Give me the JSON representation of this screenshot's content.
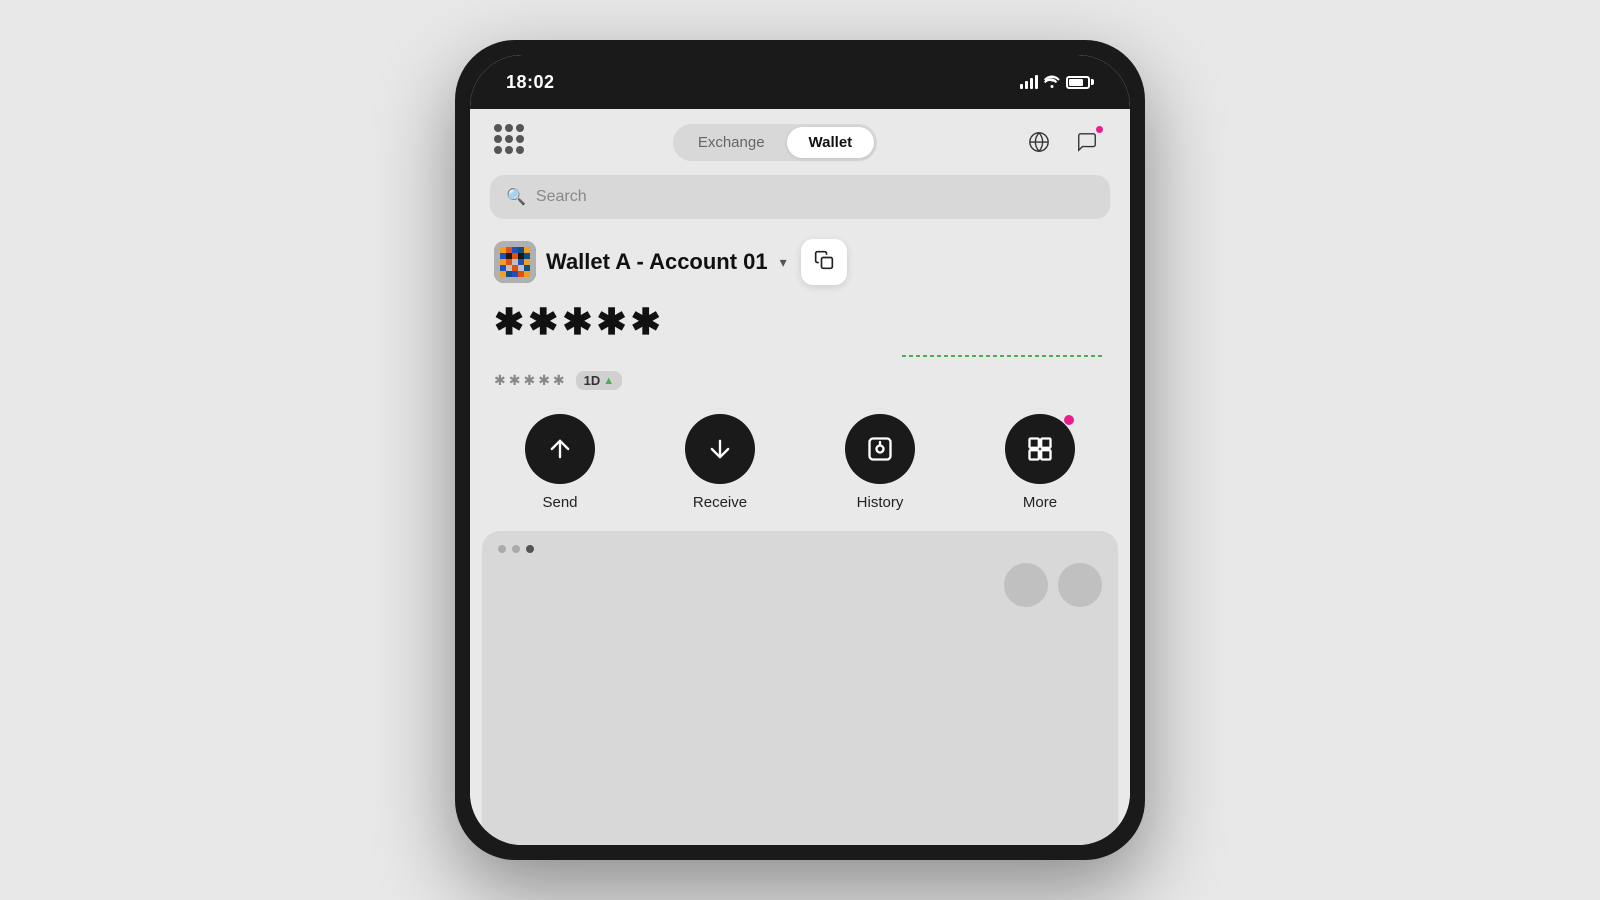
{
  "page": {
    "background": "#e8e8e8"
  },
  "statusBar": {
    "time": "18:02"
  },
  "nav": {
    "tabs": [
      {
        "id": "exchange",
        "label": "Exchange",
        "active": false
      },
      {
        "id": "wallet",
        "label": "Wallet",
        "active": true
      }
    ],
    "searchPlaceholder": "Search"
  },
  "wallet": {
    "accountName": "Wallet A - Account 01",
    "balanceMasked": "✱✱✱✱✱",
    "subBalanceMasked": "✱✱✱✱✱",
    "period": "1D",
    "periodDirection": "▲"
  },
  "actions": [
    {
      "id": "send",
      "label": "Send"
    },
    {
      "id": "receive",
      "label": "Receive"
    },
    {
      "id": "history",
      "label": "History"
    },
    {
      "id": "more",
      "label": "More"
    }
  ],
  "bottomDots": [
    {
      "active": false
    },
    {
      "active": false
    },
    {
      "active": true
    }
  ]
}
